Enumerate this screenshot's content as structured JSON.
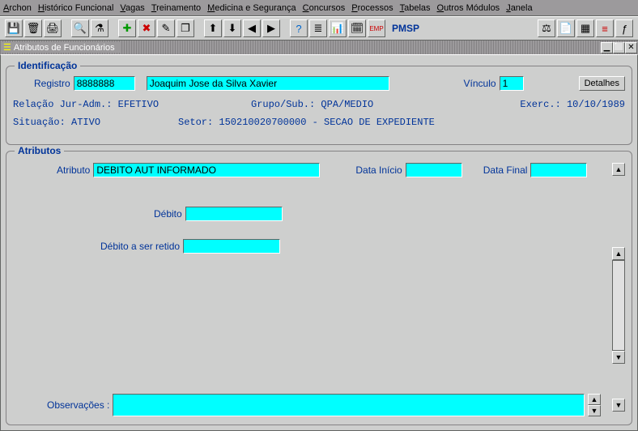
{
  "menu": {
    "archon": "Archon",
    "historico": "Histórico Funcional",
    "vagas": "Vagas",
    "treinamento": "Treinamento",
    "medicina": "Medicina e Segurança",
    "concursos": "Concursos",
    "processos": "Processos",
    "tabelas": "Tabelas",
    "outros": "Outros Módulos",
    "janela": "Janela"
  },
  "toolbar": {
    "pmsp": "PMSP"
  },
  "intwin": {
    "title": "Atributos de Funcionários"
  },
  "ident": {
    "legend": "Identificação",
    "registro_label": "Registro",
    "registro_value": "8888888",
    "nome_value": "Joaquim Jose da Silva Xavier",
    "vinculo_label": "Vínculo",
    "vinculo_value": "1",
    "detalhes_btn": "Detalhes",
    "relacao": "Relação Jur-Adm.: EFETIVO",
    "grupo": "Grupo/Sub.: QPA/MEDIO",
    "exerc": "Exerc.: 10/10/1989",
    "situacao": "Situação: ATIVO",
    "setor": "Setor: 150210020700000 - SECAO DE EXPEDIENTE"
  },
  "atrib": {
    "legend": "Atributos",
    "atributo_label": "Atributo",
    "atributo_value": "DEBITO AUT INFORMADO",
    "data_inicio_label": "Data Início",
    "data_inicio_value": "",
    "data_final_label": "Data Final",
    "data_final_value": "",
    "debito_label": "Débito",
    "debito_value": "",
    "debito_retido_label": "Débito a ser retido",
    "debito_retido_value": "",
    "obs_label": "Observações :",
    "obs_value": ""
  }
}
